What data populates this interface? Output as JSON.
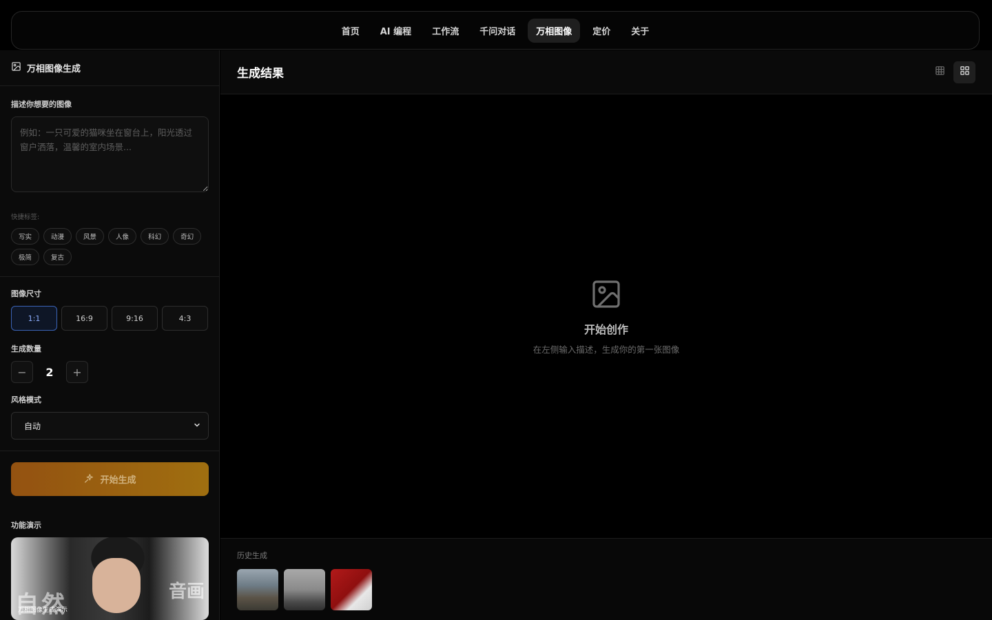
{
  "nav": {
    "items": [
      {
        "label": "首页",
        "active": false
      },
      {
        "label": "AI 编程",
        "active": false
      },
      {
        "label": "工作流",
        "active": false
      },
      {
        "label": "千问对话",
        "active": false
      },
      {
        "label": "万相图像",
        "active": true
      },
      {
        "label": "定价",
        "active": false
      },
      {
        "label": "关于",
        "active": false
      }
    ]
  },
  "sidebar": {
    "title": "万相图像生成",
    "prompt_label": "描述你想要的图像",
    "prompt_placeholder": "例如：一只可爱的猫咪坐在窗台上，阳光透过窗户洒落，温馨的室内场景...",
    "prompt_value": "",
    "tags_label": "快捷标签:",
    "tags": [
      "写实",
      "动漫",
      "风景",
      "人像",
      "科幻",
      "奇幻",
      "极简",
      "复古"
    ],
    "size_label": "图像尺寸",
    "sizes": [
      "1:1",
      "16:9",
      "9:16",
      "4:3"
    ],
    "selected_size": "1:1",
    "count_label": "生成数量",
    "count_value": "2",
    "style_label": "风格模式",
    "style_value": "自动",
    "generate_label": "开始生成",
    "demo_label": "功能演示",
    "demo_overlay_left": "自然",
    "demo_overlay_right": "音画",
    "demo_caption": "万相图像生成演示"
  },
  "main": {
    "title": "生成结果",
    "empty_title": "开始创作",
    "empty_subtitle": "在左侧输入描述，生成你的第一张图像",
    "history_label": "历史生成",
    "history_items": [
      "mountain-landscape",
      "misty-forest",
      "red-white-shoes"
    ]
  },
  "colors": {
    "accent_blue": "#3b64b8",
    "generate_gradient_start": "#a35a12",
    "generate_gradient_end": "#b07a10"
  }
}
